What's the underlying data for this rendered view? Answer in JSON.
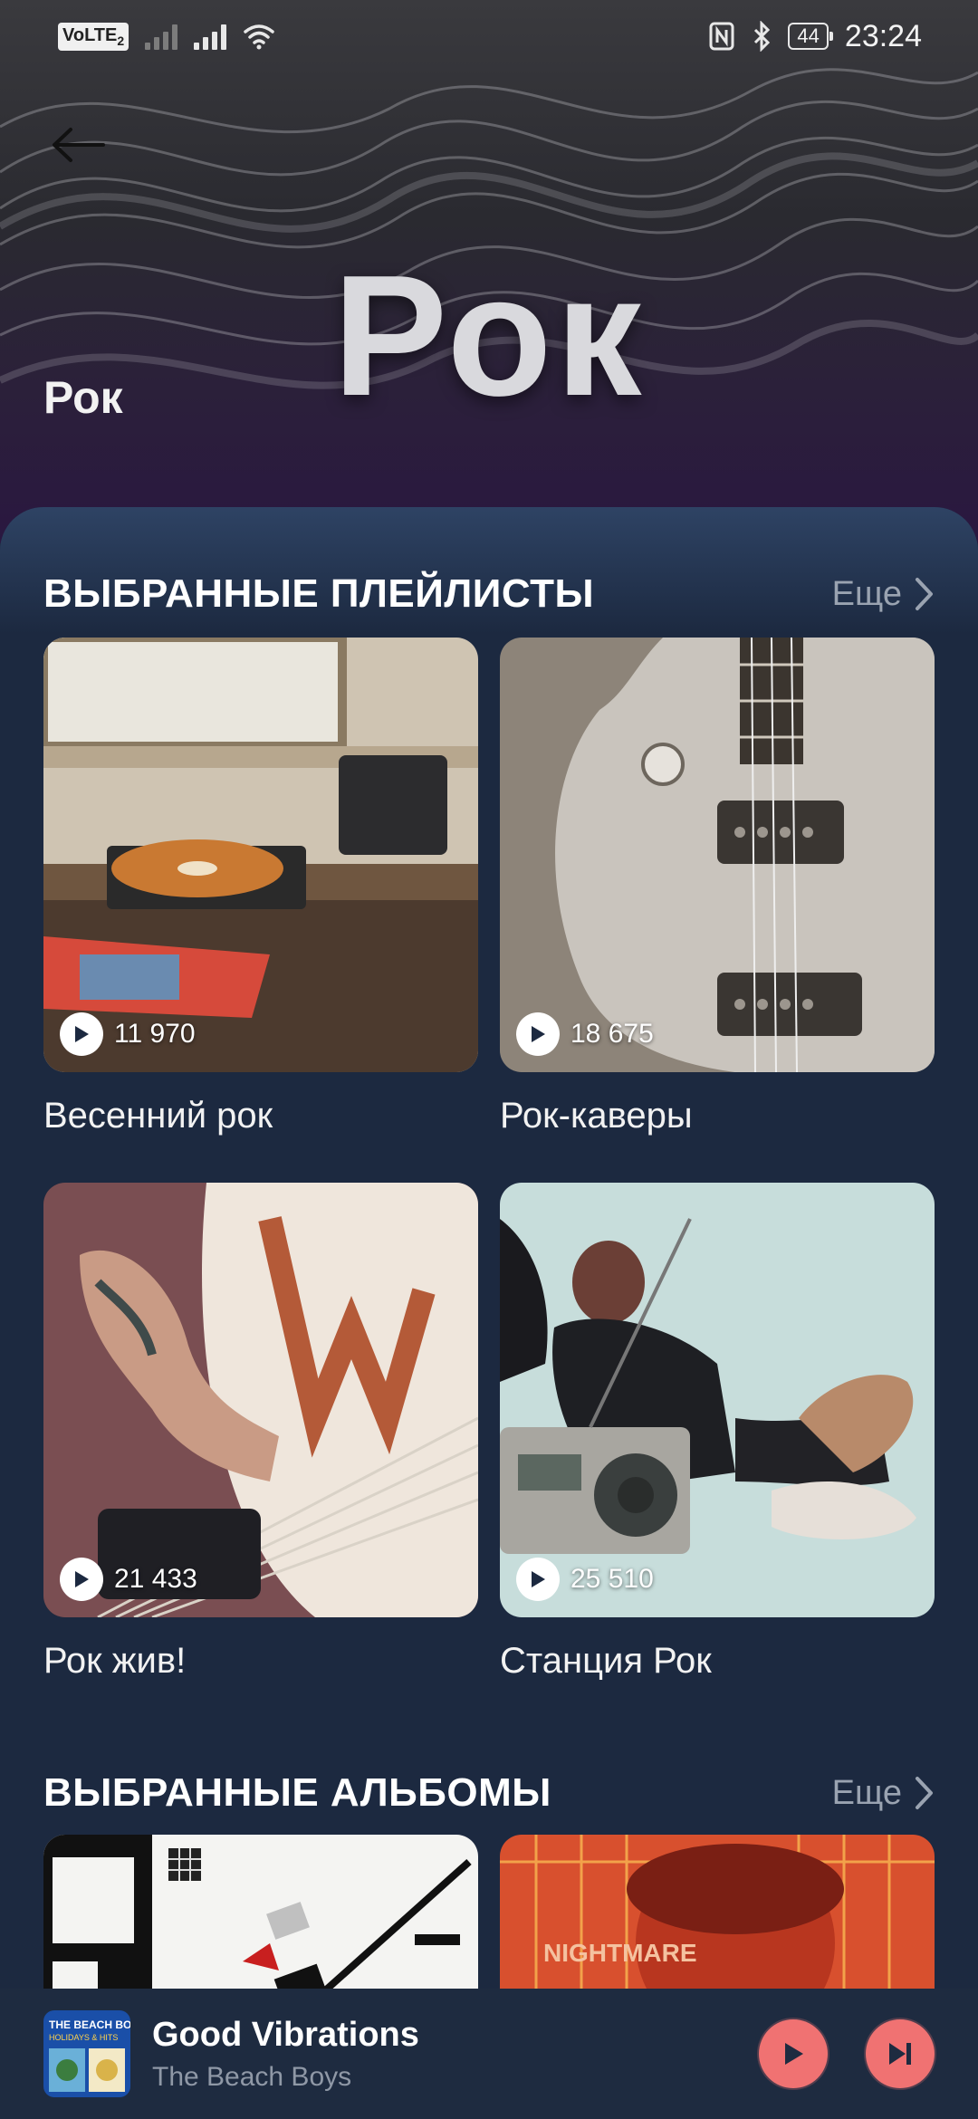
{
  "status_bar": {
    "volte": "VoLTE",
    "sim": "2",
    "battery": "44",
    "time": "23:24",
    "icons": [
      "signal-icon",
      "wifi-icon",
      "nfc-icon",
      "bluetooth-icon",
      "battery-icon"
    ]
  },
  "header": {
    "hero_text": "Рок",
    "title": "Рок",
    "back_icon": "arrow-left-icon"
  },
  "sections": {
    "playlists": {
      "title": "ВЫБРАННЫЕ ПЛЕЙЛИСТЫ",
      "more": "Еще",
      "items": [
        {
          "title": "Весенний рок",
          "plays": "11 970"
        },
        {
          "title": "Рок-каверы",
          "plays": "18 675"
        },
        {
          "title": "Рок жив!",
          "plays": "21 433"
        },
        {
          "title": "Станция Рок",
          "plays": "25 510"
        }
      ]
    },
    "albums": {
      "title": "ВЫБРАННЫЕ АЛЬБОМЫ",
      "more": "Еще",
      "items": [
        {
          "cover_text": ""
        },
        {
          "cover_text": "NIGHTMARE"
        }
      ]
    }
  },
  "mini_player": {
    "title": "Good Vibrations",
    "artist": "The Beach Boys",
    "cover_text": "THE BEACH BOYS",
    "cover_subtext": "HOLIDAYS & HITS",
    "accent": "#f07272"
  },
  "colors": {
    "background": "#1c2940",
    "muted_text": "#9aa3b1",
    "accent": "#f07272"
  }
}
